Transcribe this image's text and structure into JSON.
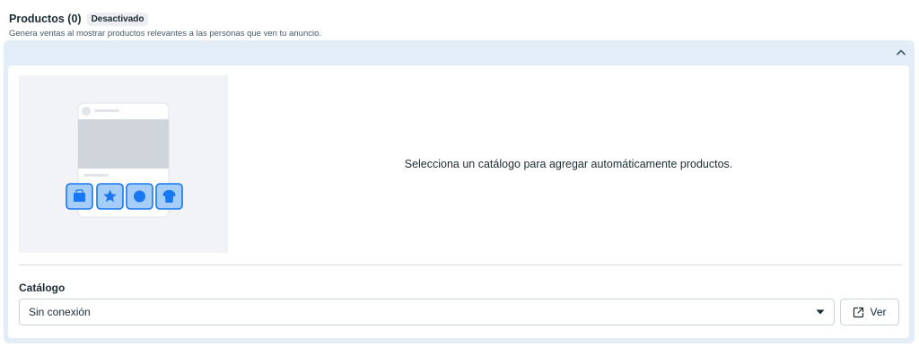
{
  "section": {
    "title": "Productos (0)",
    "status_badge": "Desactivado",
    "description": "Genera ventas al mostrar productos relevantes a las personas que ven tu anuncio."
  },
  "panel": {
    "collapse_icon": "chevron-up-icon",
    "message": "Selecciona un catálogo para agregar automáticamente productos.",
    "illustration": {
      "product_icons": [
        "bag-icon",
        "star-icon",
        "circle-icon",
        "shirt-icon"
      ]
    }
  },
  "catalog": {
    "label": "Catálogo",
    "selected_value": "Sin conexión",
    "dropdown_icon": "caret-down-icon",
    "view_button": {
      "label": "Ver",
      "icon": "external-link-icon"
    }
  },
  "colors": {
    "accent": "#1877f2",
    "accent_light": "#a6cdf7",
    "panel_bg": "#e3edf8"
  }
}
